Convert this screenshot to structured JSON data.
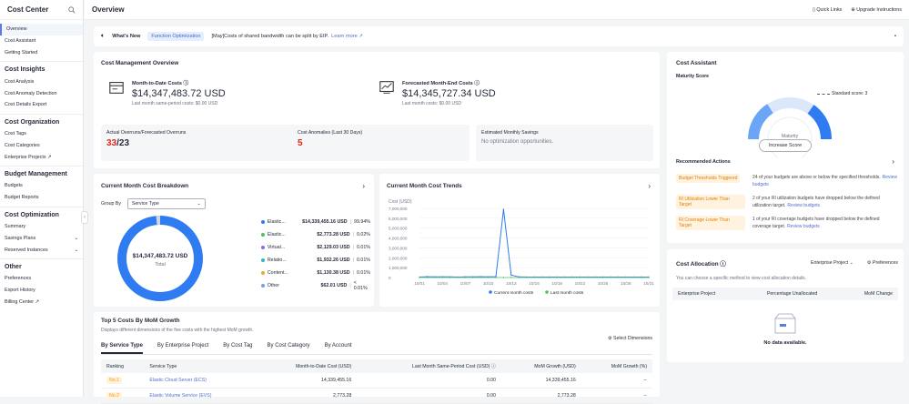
{
  "sidebar": {
    "title": "Cost Center",
    "items": [
      {
        "label": "Overview",
        "active": true
      },
      {
        "label": "Cost Assistant"
      },
      {
        "label": "Getting Started"
      }
    ],
    "groups": [
      {
        "title": "Cost Insights",
        "items": [
          "Cost Analysis",
          "Cost Anomaly Detection",
          "Cost Details Export"
        ]
      },
      {
        "title": "Cost Organization",
        "items": [
          "Cost Tags",
          "Cost Categories",
          "Enterprise Projects ↗"
        ]
      },
      {
        "title": "Budget Management",
        "items": [
          "Budgets",
          "Budget Reports"
        ]
      },
      {
        "title": "Cost Optimization",
        "items": [
          "Summary",
          "Savings Plans",
          "Reserved Instances"
        ]
      },
      {
        "title": "Other",
        "items": [
          "Preferences",
          "Export History",
          "Billing Center ↗"
        ]
      }
    ]
  },
  "topbar": {
    "title": "Overview",
    "quick_links": "Quick Links",
    "upgrade": "Upgrade Instructions"
  },
  "whats_new": {
    "label": "What's New",
    "tag": "Function Optimization",
    "text": "[May]Costs of shared bandwidth can be split by EIP.",
    "link": "Learn more ↗"
  },
  "overview": {
    "title": "Cost Management Overview",
    "mtd_label": "Month-to-Date Costs ⓘ",
    "mtd_value": "$14,347,483.72 USD",
    "mtd_sub": "Last month same-period costs: $0.00 USD",
    "fme_label": "Forecasted Month-End Costs ⓘ",
    "fme_value": "$14,345,727.34 USD",
    "fme_sub": "Last month costs: $0.00 USD",
    "overrun_label": "Actual Overruns/Forecasted Overruns",
    "overrun_actual": "33",
    "overrun_forecast": "/23",
    "anomalies_label": "Cost Anomalies (Last 30 Days)",
    "anomalies_value": "5",
    "savings_label": "Estimated Monthly Savings",
    "savings_value": "No optimization opportunities."
  },
  "breakdown": {
    "title": "Current Month Cost Breakdown",
    "group_by_label": "Group By",
    "group_by_value": "Service Type",
    "total_value": "$14,347,483.72 USD",
    "total_label": "Total",
    "legend": [
      {
        "name": "Elastic...",
        "value": "$14,339,455.16 USD",
        "pct": "99.94%",
        "color": "#2f7bf2"
      },
      {
        "name": "Elastic...",
        "value": "$2,773.28 USD",
        "pct": "0.02%",
        "color": "#4fbf67"
      },
      {
        "name": "Virtual...",
        "value": "$2,129.03 USD",
        "pct": "0.01%",
        "color": "#8c6ee0"
      },
      {
        "name": "Relatio...",
        "value": "$1,932.26 USD",
        "pct": "0.01%",
        "color": "#34b3c9"
      },
      {
        "name": "Content...",
        "value": "$1,130.38 USD",
        "pct": "0.01%",
        "color": "#f2a33a"
      },
      {
        "name": "Other",
        "value": "$62.01 USD",
        "pct": "< 0.01%",
        "color": "#6fa3e8"
      }
    ]
  },
  "chart_data": {
    "type": "line",
    "title": "Current Month Cost Trends",
    "ylabel": "Cost (USD)",
    "yticks": [
      "7,000,000",
      "6,000,000",
      "5,000,000",
      "4,000,000",
      "3,000,000",
      "2,000,000",
      "1,000,000",
      "0"
    ],
    "ylim": [
      0,
      7000000
    ],
    "xticks": [
      "10/01",
      "10/04",
      "10/07",
      "10/10",
      "10/13",
      "10/16",
      "10/19",
      "10/22",
      "10/25",
      "10/28",
      "10/31"
    ],
    "series": [
      {
        "name": "Current month costs",
        "color": "#2f7bf2",
        "values": [
          50000,
          80000,
          60000,
          70000,
          60000,
          50000,
          60000,
          70000,
          80000,
          60000,
          90000,
          6900000,
          250000,
          60000,
          50000,
          50000,
          50000,
          50000,
          50000,
          50000,
          50000,
          50000,
          50000,
          50000,
          50000,
          50000,
          50000,
          50000,
          50000,
          50000,
          50000
        ]
      },
      {
        "name": "Last month costs",
        "color": "#4fbf67",
        "values": [
          0,
          0,
          0,
          0,
          0,
          0,
          0,
          0,
          0,
          0,
          0,
          0,
          0,
          0,
          0,
          0,
          0,
          0,
          0,
          0,
          0,
          0,
          0,
          0,
          0,
          0,
          0,
          0,
          0,
          0,
          0
        ]
      }
    ],
    "legend_position": "bottom"
  },
  "top5": {
    "title": "Top 5 Costs By MoM Growth",
    "desc": "Displays different dimensions of the five costs with the highest MoM growth.",
    "select_dims": "Select Dimensions",
    "tabs": [
      "By Service Type",
      "By Enterprise Project",
      "By Cost Tag",
      "By Cost Category",
      "By Account"
    ],
    "columns": [
      "Ranking",
      "Service Type",
      "Month-to-Date Cost (USD)",
      "Last Month Same-Period Cost (USD) ⓘ",
      "MoM Growth (USD)",
      "MoM Growth (%)"
    ],
    "rows": [
      {
        "rank": "No.1",
        "service": "Elastic Cloud Server (ECS)",
        "mtd": "14,339,455.16",
        "last": "0.00",
        "growth": "14,339,455.16",
        "pct": "--"
      },
      {
        "rank": "No.2",
        "service": "Elastic Volume Service (EVS)",
        "mtd": "2,773.28",
        "last": "0.00",
        "growth": "2,773.28",
        "pct": "--"
      }
    ]
  },
  "assistant": {
    "title": "Cost Assistant",
    "maturity_label": "Maturity Score",
    "standard": "Standard score: 3",
    "gauge_label": "Maturity",
    "gauge_value": "5",
    "increase": "Increase Score",
    "rec_title": "Recommended Actions",
    "actions": [
      {
        "tag": "Budget Thresholds Triggered",
        "text": "24 of your budgets are above or below the specified thresholds.",
        "link": "Review budgets"
      },
      {
        "tag": "RI Utilization Lower Than Target",
        "text": "2 of your RI utilization budgets have dropped below the defined utilization target.",
        "link": "Review budgets"
      },
      {
        "tag": "RI Coverage Lower Than Target",
        "text": "1 of your RI coverage budgets have dropped below the defined coverage target.",
        "link": "Review budgets"
      }
    ]
  },
  "allocation": {
    "title": "Cost Allocation ⓘ",
    "dropdown": "Enterprise Project",
    "prefs": "Preferences",
    "desc": "You can choose a specific method to view cost allocation details.",
    "columns": [
      "Enterprise Project",
      "Percentage Unallocated",
      "MoM Change"
    ],
    "empty": "No data available."
  }
}
